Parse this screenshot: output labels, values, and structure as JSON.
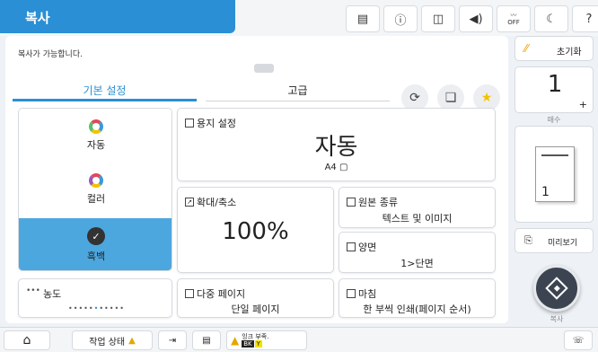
{
  "header": {
    "title": "복사",
    "status_icons": [
      "document-icon",
      "info-icon",
      "wifi-icon",
      "speaker-icon",
      "wifi-off-icon",
      "moon-icon",
      "help-icon"
    ],
    "wifi_off_label": "OFF"
  },
  "main": {
    "status_message": "복사가 가능합니다.",
    "page_indicator": "",
    "tabs": [
      {
        "label": "기본 설정",
        "active": true
      },
      {
        "label": "고급",
        "active": false
      }
    ],
    "color_options": [
      {
        "label": "자동",
        "selected": false
      },
      {
        "label": "컬러",
        "selected": false
      },
      {
        "label": "흑백",
        "selected": true
      }
    ],
    "density": {
      "label": "농도"
    },
    "paper_setting": {
      "title": "용지 설정",
      "value": "자동",
      "sub": "A4 ▢"
    },
    "zoom": {
      "title": "확대/축소",
      "value": "100%"
    },
    "original_type": {
      "title": "원본 종류",
      "value": "텍스트 및 이미지"
    },
    "duplex": {
      "title": "양면",
      "value": "1>단면"
    },
    "multi_page": {
      "title": "다중 페이지",
      "value": "단일 페이지"
    },
    "finishing": {
      "title": "마침",
      "value": "한 부씩 인쇄(페이지 순서)"
    }
  },
  "right": {
    "reset_label": "초기화",
    "copies_value": "1",
    "copies_plus": "+",
    "copies_label": "매수",
    "preview_label": "미리보기",
    "start_label": "복사"
  },
  "footer": {
    "job_status_label": "작업 상태",
    "ink_low_label": "잉크 부족.",
    "ink_codes": [
      "BK",
      "Y"
    ]
  },
  "colors": {
    "accent": "#2a8fd4",
    "selected_bg": "#4da7df",
    "warning": "#f2c200"
  }
}
